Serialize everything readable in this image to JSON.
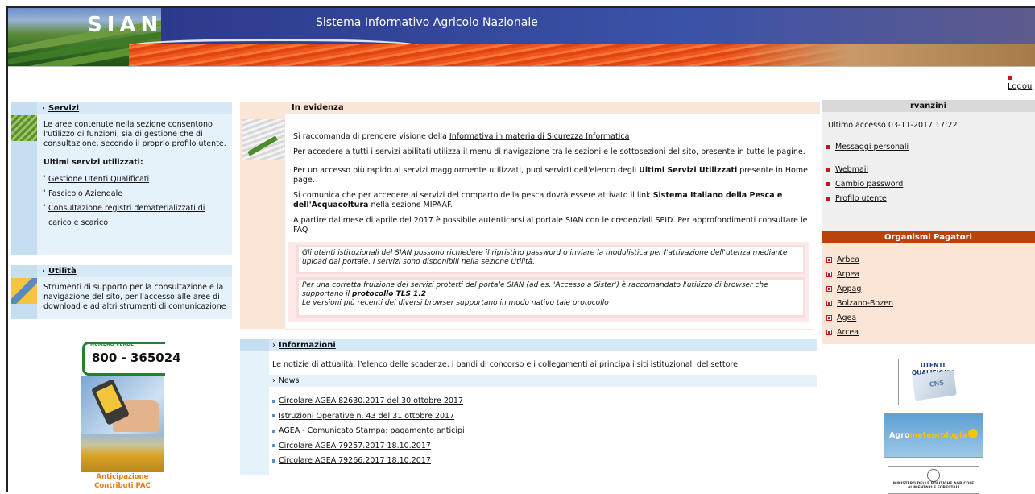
{
  "header": {
    "logo": "SIAN",
    "title": "Sistema Informativo Agricolo Nazionale"
  },
  "logout_label": "Logou",
  "left": {
    "servizi": {
      "title": "Servizi",
      "description": "Le aree contenute nella sezione consentono l'utilizzo di funzioni, sia di gestione che di consultazione, secondo il proprio profilo utente.",
      "recent_title": "Ultimi servizi utilizzati:",
      "recent": [
        "Gestione Utenti Qualificati",
        "Fascicolo Aziendale",
        "Consultazione registri dematerializzati di carico e scarico"
      ]
    },
    "utilita": {
      "title": "Utilità",
      "description": "Strumenti di supporto per la consultazione e la navigazione del sito, per l'accesso alle aree di download e ad altri strumenti di comunicazione"
    },
    "numero_verde": {
      "label": "NUMERO VERDE",
      "number": "800 - 365024"
    },
    "pac": {
      "line1": "Anticipazione",
      "line2": "Contributi PAC"
    }
  },
  "evidenza": {
    "title": "In evidenza",
    "p1_prefix": "Si raccomanda di prendere visione della ",
    "p1_link": "Informativa in materia di Sicurezza Informatica",
    "p2": "Per accedere a tutti i servizi abilitati utilizza il menu di navigazione tra le sezioni e le sottosezioni del sito, presente in tutte le pagine.",
    "p3_a": "Per un accesso più rapido ai servizi maggiormente utilizzati, puoi servirti dell'elenco degli ",
    "p3_b": "Ultimi Servizi Utilizzati",
    "p3_c": " presente in Home page.",
    "p4_a": "Si comunica che per accedere ai servizi del comparto della pesca dovrà essere attivato il link ",
    "p4_b": "Sistema Italiano della Pesca e dell'Acquacoltura",
    "p4_c": " nella sezione MIPAAF.",
    "p5": "A partire dal mese di aprile del 2017 è possibile autenticarsi al portale SIAN con le credenziali SPID. Per approfondimenti consultare le FAQ",
    "note1": "Gli utenti istituzionali del SIAN possono richiedere il ripristino password o inviare la modulistica per l'attivazione dell'utenza mediante upload dal portale. I servizi sono disponibili nella sezione Utilità.",
    "note2_a": "Per una corretta fruizione dei servizi protetti del portale SIAN (ad es. 'Accesso a Sister') è raccomandato l'utilizzo di browser che supportano il ",
    "note2_b": "protocollo TLS 1.2",
    "note2_c": "Le versioni più recenti dei diversi browser supportano in modo nativo tale protocollo"
  },
  "informazioni": {
    "title": "Informazioni",
    "text": "Le notizie di attualità, l'elenco delle scadenze, i bandi di concorso e i collegamenti ai principali siti istituzionali del settore.",
    "news_title": "News",
    "news": [
      "Circolare AGEA.82630.2017 del 30 ottobre 2017",
      "Istruzioni Operative n. 43 del 31 ottobre 2017",
      "AGEA - Comunicato Stampa: pagamento anticipi",
      "Circolare AGEA.79257.2017 18.10.2017",
      "Circolare AGEA.79266.2017 18.10.2017"
    ]
  },
  "user": {
    "name": "rvanzini",
    "last_access": "Ultimo accesso 03-11-2017 17:22",
    "links_a": [
      "Messaggi personali"
    ],
    "links_b": [
      "Webmail",
      "Cambio password",
      "Profilo utente"
    ]
  },
  "organismi": {
    "title": "Organismi Pagatori",
    "items": [
      "Arbea",
      "Arpea",
      "Appag",
      "Bolzano-Bozen",
      "Agea",
      "Arcea"
    ]
  },
  "banners": {
    "uq_title": "UTENTI QUALIFICATI",
    "uq_card": "CNS",
    "agro_a": "Agro",
    "agro_b": "meteorologia",
    "mipaaf": "MINISTERO DELLE POLITICHE AGRICOLE ALIMENTARI E FORESTALI"
  },
  "colors": {
    "accent_red": "#c4161c",
    "header_blue": "#3f4a93",
    "org_head": "#b8440a"
  }
}
